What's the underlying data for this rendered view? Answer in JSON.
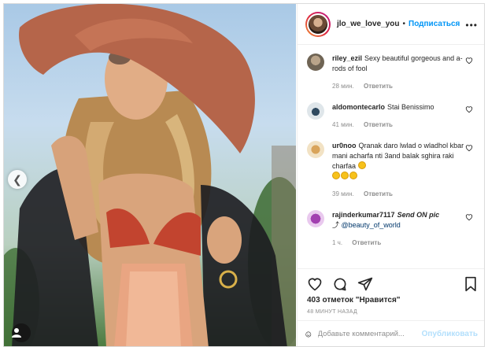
{
  "post": {
    "username": "jlo_we_love_you",
    "follow_label": "Подписаться",
    "more_label": "•••",
    "likes": "403 отметок \"Нравится\"",
    "time": "48 минут назад"
  },
  "comments": [
    {
      "user": "riley_ezil",
      "text": "Sexy beautiful gorgeous and a-rods of fool",
      "time": "28 мин.",
      "reply": "Ответить"
    },
    {
      "user": "aldomontecarlo",
      "text": "Stai Benissimo",
      "time": "41 мин.",
      "reply": "Ответить"
    },
    {
      "user": "ur0noo",
      "text": "Qranak daro lwlad o wladhol kbar mani acharfa nti 3and balak sghira raki charfaa",
      "time": "39 мин.",
      "reply": "Ответить"
    },
    {
      "user": "rajinderkumar7117",
      "text": "Send ON pic",
      "mention": "@beauty_of_world",
      "time": "1 ч.",
      "reply": "Ответить"
    }
  ],
  "composer": {
    "placeholder": "Добавьте комментарий...",
    "publish_label": "Опубликовать"
  },
  "icons": [
    "chevron-left-icon",
    "user-tag-icon",
    "heart-icon",
    "comment-icon",
    "share-icon",
    "bookmark-icon",
    "emoji-icon",
    "more-icon"
  ]
}
